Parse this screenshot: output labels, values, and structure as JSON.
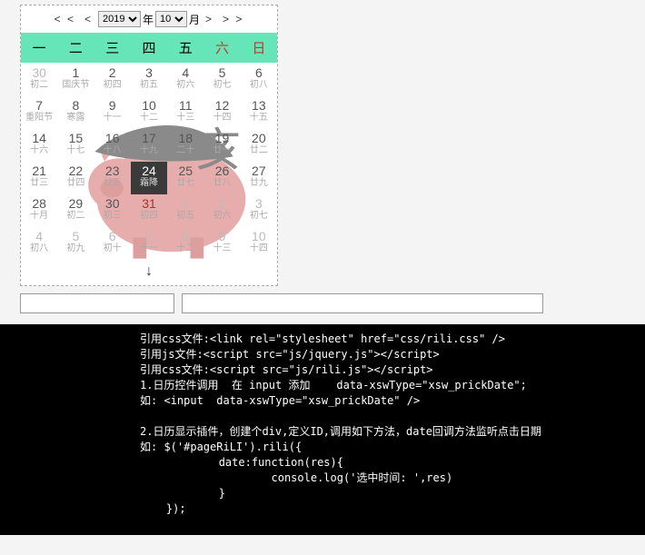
{
  "nav": {
    "prev_year": "< <",
    "prev_month": "<",
    "next_month": ">",
    "next_year": "> >",
    "year_value": "2019",
    "year_suffix": "年",
    "month_value": "10",
    "month_suffix": "月"
  },
  "weekdays": [
    {
      "label": "一",
      "weekend": false
    },
    {
      "label": "二",
      "weekend": false
    },
    {
      "label": "三",
      "weekend": false
    },
    {
      "label": "四",
      "weekend": false
    },
    {
      "label": "五",
      "weekend": false
    },
    {
      "label": "六",
      "weekend": true
    },
    {
      "label": "日",
      "weekend": true
    }
  ],
  "cells": [
    {
      "d": "30",
      "l": "初二",
      "dim": true
    },
    {
      "d": "1",
      "l": "国庆节"
    },
    {
      "d": "2",
      "l": "初四"
    },
    {
      "d": "3",
      "l": "初五"
    },
    {
      "d": "4",
      "l": "初六"
    },
    {
      "d": "5",
      "l": "初七"
    },
    {
      "d": "6",
      "l": "初八"
    },
    {
      "d": "7",
      "l": "重阳节"
    },
    {
      "d": "8",
      "l": "寒露"
    },
    {
      "d": "9",
      "l": "十一"
    },
    {
      "d": "10",
      "l": "十二"
    },
    {
      "d": "11",
      "l": "十三"
    },
    {
      "d": "12",
      "l": "十四"
    },
    {
      "d": "13",
      "l": "十五"
    },
    {
      "d": "14",
      "l": "十六"
    },
    {
      "d": "15",
      "l": "十七"
    },
    {
      "d": "16",
      "l": "十八"
    },
    {
      "d": "17",
      "l": "十九"
    },
    {
      "d": "18",
      "l": "二十"
    },
    {
      "d": "19",
      "l": "廿一"
    },
    {
      "d": "20",
      "l": "廿二"
    },
    {
      "d": "21",
      "l": "廿三"
    },
    {
      "d": "22",
      "l": "廿四"
    },
    {
      "d": "23",
      "l": "廿五"
    },
    {
      "d": "24",
      "l": "霜降",
      "today": true
    },
    {
      "d": "25",
      "l": "廿七"
    },
    {
      "d": "26",
      "l": "廿八"
    },
    {
      "d": "27",
      "l": "廿九"
    },
    {
      "d": "28",
      "l": "十月"
    },
    {
      "d": "29",
      "l": "初二"
    },
    {
      "d": "30",
      "l": "初三"
    },
    {
      "d": "31",
      "l": "初四",
      "sp": true
    },
    {
      "d": "1",
      "l": "初五",
      "dim": true
    },
    {
      "d": "2",
      "l": "初六",
      "dim": true
    },
    {
      "d": "3",
      "l": "初七",
      "dim": true
    },
    {
      "d": "4",
      "l": "初八",
      "dim": true
    },
    {
      "d": "5",
      "l": "初九",
      "dim": true
    },
    {
      "d": "6",
      "l": "初十",
      "dim": true
    },
    {
      "d": "7",
      "l": "十一",
      "dim": true
    },
    {
      "d": "8",
      "l": "十二",
      "dim": true
    },
    {
      "d": "9",
      "l": "十三",
      "dim": true
    },
    {
      "d": "10",
      "l": "十四",
      "dim": true
    }
  ],
  "arrow": "↓",
  "inputs": {
    "a": "",
    "b": ""
  },
  "code_lines": [
    "引用css文件:<link rel=\"stylesheet\" href=\"css/rili.css\" />",
    "引用js文件:<script src=\"js/jquery.js\"></script>",
    "引用css文件:<script src=\"js/rili.js\"></script>",
    "1.日历控件调用  在 input 添加    data-xswType=\"xsw_prickDate\";",
    "如: <input  data-xswType=\"xsw_prickDate\" />",
    "",
    "2.日历显示插件，创建个div,定义ID,调用如下方法，date回调方法监听点击日期",
    "如: $('#pageRiLI').rili({",
    "            date:function(res){",
    "                    console.log('选中时间: ',res)",
    "            }",
    "    });"
  ]
}
